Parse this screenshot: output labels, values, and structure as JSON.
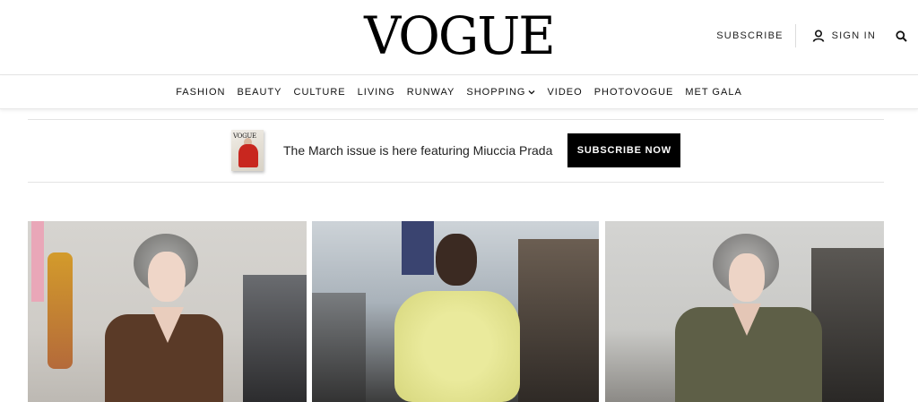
{
  "header": {
    "logo": "VOGUE",
    "subscribe_label": "SUBSCRIBE",
    "signin_label": "SIGN IN"
  },
  "nav": {
    "items": [
      "FASHION",
      "BEAUTY",
      "CULTURE",
      "LIVING",
      "RUNWAY",
      "SHOPPING",
      "VIDEO",
      "PHOTOVOGUE",
      "MET GALA"
    ]
  },
  "promo": {
    "text": "The March issue is here featuring Miuccia Prada",
    "button_label": "SUBSCRIBE NOW",
    "cover_title": "VOGUE"
  },
  "icons": {
    "user": "user-icon",
    "search": "search-icon",
    "chevron": "chevron-down-icon"
  },
  "colors": {
    "button_bg": "#000000",
    "button_text": "#ffffff"
  }
}
